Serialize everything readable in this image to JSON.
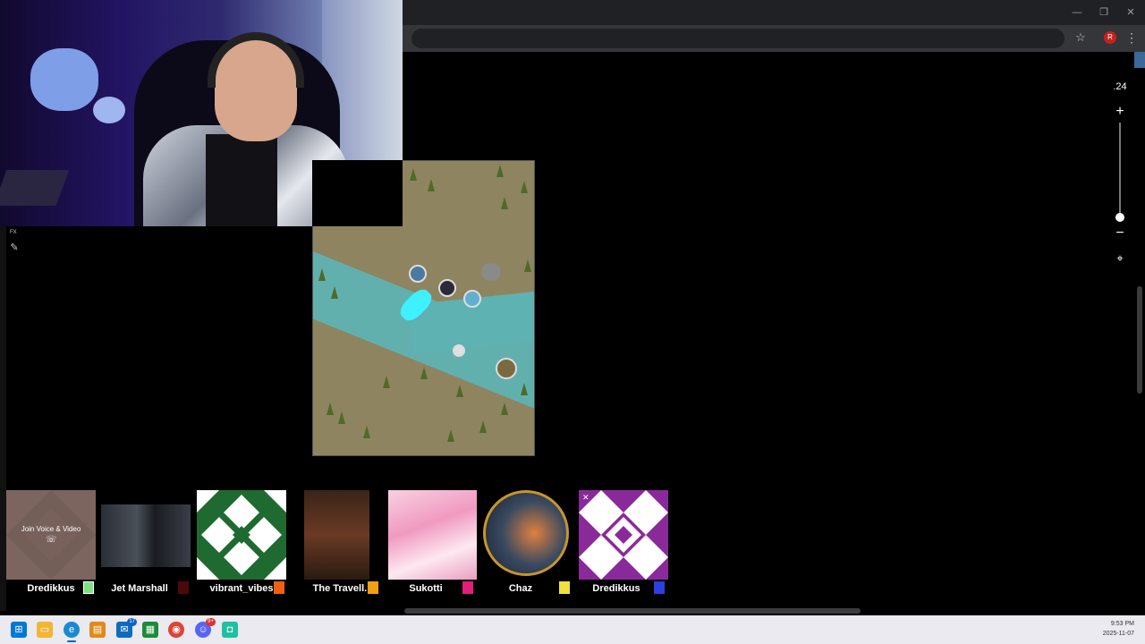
{
  "browser": {
    "window_controls": [
      "—",
      "❐",
      "✕"
    ],
    "profile_initial": "R"
  },
  "fx_panel": {
    "label": "FX"
  },
  "zoom": {
    "value": ".24",
    "level_fraction": 0.95
  },
  "players": [
    {
      "name": "Dredikkus",
      "color": "#7ee07e",
      "join_label": "Join Voice & Video"
    },
    {
      "name": "Jet Marshall",
      "color": "#4a0a0a"
    },
    {
      "name": "vibrant_vibes",
      "color": "#f06010"
    },
    {
      "name": "The Travell...",
      "color": "#f0a010"
    },
    {
      "name": "Sukotti",
      "color": "#e0207a"
    },
    {
      "name": "Chaz",
      "color": "#f0e040"
    },
    {
      "name": "Dredikkus",
      "color": "#2a40e0"
    }
  ],
  "taskbar": {
    "apps": [
      "start-icon",
      "file-explorer-icon",
      "edge-icon",
      "folder-icon",
      "outlook-icon",
      "spreadsheet-icon",
      "chrome-icon",
      "discord-icon",
      "app-icon"
    ],
    "outlook_badge": "17",
    "discord_badge": "9+",
    "time": "9:53 PM",
    "date": "2025-11-07"
  }
}
